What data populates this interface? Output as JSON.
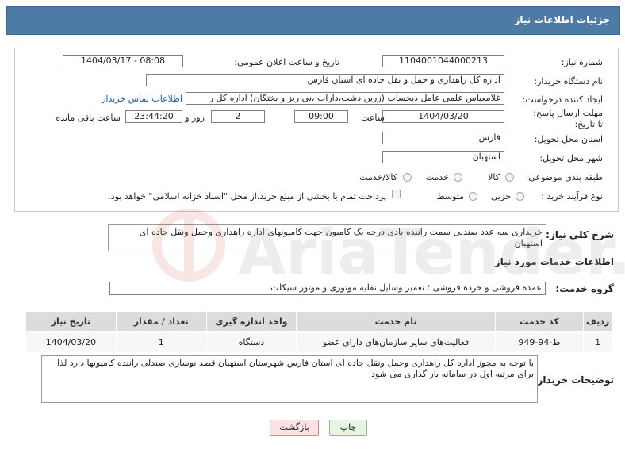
{
  "header": {
    "title": "جزئیات اطلاعات نیاز"
  },
  "form": {
    "need_number": {
      "label": "شماره نیاز:",
      "value": "1104001044000213"
    },
    "announce_datetime": {
      "label": "تاریخ و ساعت اعلان عمومی:",
      "value": "1404/03/17 - 08:08"
    },
    "buyer_org": {
      "label": "نام دستگاه خریدار:",
      "value": "اداره کل راهداری و حمل و نقل جاده ای استان فارس"
    },
    "creator": {
      "label": "ایجاد کننده درخواست:",
      "value": "غلامعباس علمی عامل ذیحساب (زرین دشت،داراب ،نی ریز و بختگان) اداره کل ر",
      "contact_link": "اطلاعات تماس خریدار"
    },
    "deadline": {
      "label": "مهلت ارسال پاسخ: تا تاریخ:",
      "date": "1404/03/20",
      "time_label": "ساعت",
      "time": "09:00",
      "days": "2",
      "days_label": "روز و",
      "remaining": "23:44:20",
      "remaining_label": "ساعت باقی مانده"
    },
    "province": {
      "label": "استان محل تحویل:",
      "value": "فارس"
    },
    "city": {
      "label": "شهر محل تحویل:",
      "value": "استهبان"
    },
    "category": {
      "label": "طبقه بندی موضوعی:",
      "opt1": "کالا",
      "opt2": "خدمت",
      "opt3": "کالا/خدمت"
    },
    "process": {
      "label": "نوع فرآیند خرید :",
      "opt1": "جزیی",
      "opt2": "متوسط",
      "note": "پرداخت تمام یا بخشی از مبلغ خرید،از محل \"اسناد خزانه اسلامی\" خواهد بود."
    }
  },
  "summary": {
    "label": "شرح کلی نیاز:",
    "text": "خریداری سه عدد صندلی سمت راننده بادی درجه یک کامیون جهت کامیونهای اداره راهداری وحمل ونقل جاده ای استهبان"
  },
  "services": {
    "section_title": "اطلاعات خدمات مورد نیاز",
    "group_label": "گروه خدمت:",
    "group_value": "عمده فروشی و خرده فروشی ؛ تعمیر وسایل نقلیه موتوری و موتور سیکلت",
    "columns": [
      "ردیف",
      "کد خدمت",
      "نام خدمت",
      "واحد اندازه گیری",
      "تعداد / مقدار",
      "تاریخ نیاز"
    ],
    "rows": [
      {
        "row": "1",
        "code": "ط-94-949",
        "name": "فعالیت‌های سایر سازمان‌های دارای عضو",
        "unit": "دستگاه",
        "qty": "1",
        "date": "1404/03/20"
      }
    ]
  },
  "buyer_notes": {
    "label": "توضیحات خریدار:",
    "text": "با توجه به مجوز اداره کل راهداری وحمل ونقل جاده ای استان فارس شهرستان استهبان قصد نوسازی صندلی راننده کامیونها دارد لذا برای مرتبه اول در سامانه بار گذاری می شود"
  },
  "buttons": {
    "print": "چاپ",
    "back": "بازگشت"
  },
  "watermark": {
    "text": "AriaTender.net"
  },
  "colors": {
    "header": "#4e7ba6",
    "link": "#1a5fb4",
    "back_bg": "#fbe3e3",
    "print_bg": "#e6f5e1"
  }
}
